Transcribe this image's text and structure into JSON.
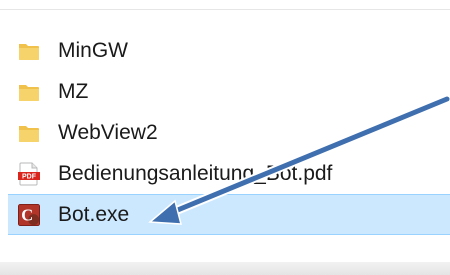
{
  "files": [
    {
      "name": "MinGW",
      "icon": "folder-icon"
    },
    {
      "name": "MZ",
      "icon": "folder-icon"
    },
    {
      "name": "WebView2",
      "icon": "folder-icon"
    },
    {
      "name": "Bedienungsanleitung_Bot.pdf",
      "icon": "pdf-icon",
      "icon_label": "PDF"
    },
    {
      "name": "Bot.exe",
      "icon": "app-icon",
      "icon_label": "C",
      "selected": true
    }
  ],
  "colors": {
    "folder": "#f0c24b",
    "pdf_accent": "#d9251c",
    "app_icon": "#b2352a",
    "selection_fill": "#cce8ff",
    "selection_border": "#99d1ff",
    "arrow": "#3f6fae"
  }
}
